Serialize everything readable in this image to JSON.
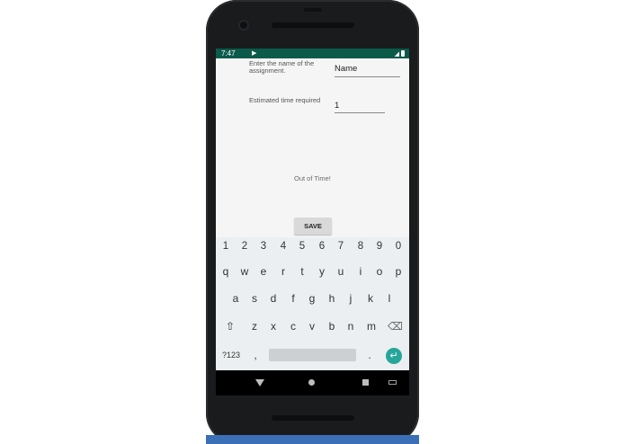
{
  "status_bar": {
    "time": "7:47",
    "play_glyph": "▶",
    "signal_glyph": "◢"
  },
  "form": {
    "assignment_name_label": "Enter the name of the assignment.",
    "assignment_name_value": "Name",
    "time_label": "Estimated time required",
    "time_value": "1",
    "message": "Out of Time!",
    "save_label": "SAVE"
  },
  "keyboard": {
    "number_row": [
      "1",
      "2",
      "3",
      "4",
      "5",
      "6",
      "7",
      "8",
      "9",
      "0"
    ],
    "row1": [
      "q",
      "w",
      "e",
      "r",
      "t",
      "y",
      "u",
      "i",
      "o",
      "p"
    ],
    "row2": [
      "a",
      "s",
      "d",
      "f",
      "g",
      "h",
      "j",
      "k",
      "l"
    ],
    "row3": [
      "z",
      "x",
      "c",
      "v",
      "b",
      "n",
      "m"
    ],
    "shift_glyph": "⇧",
    "backspace_glyph": "⌫",
    "symbols_label": "?123",
    "comma": ",",
    "period": ".",
    "enter_glyph": "↵"
  },
  "icons": {
    "camera": "camera-icon",
    "back": "back-triangle-icon",
    "home": "home-circle-icon",
    "recents": "recents-square-icon",
    "keyboard_switch": "keyboard-icon"
  },
  "colors": {
    "status_bar": "#0b5a4a",
    "accent": "#26a69a",
    "phone_body": "#1a1b1d"
  }
}
